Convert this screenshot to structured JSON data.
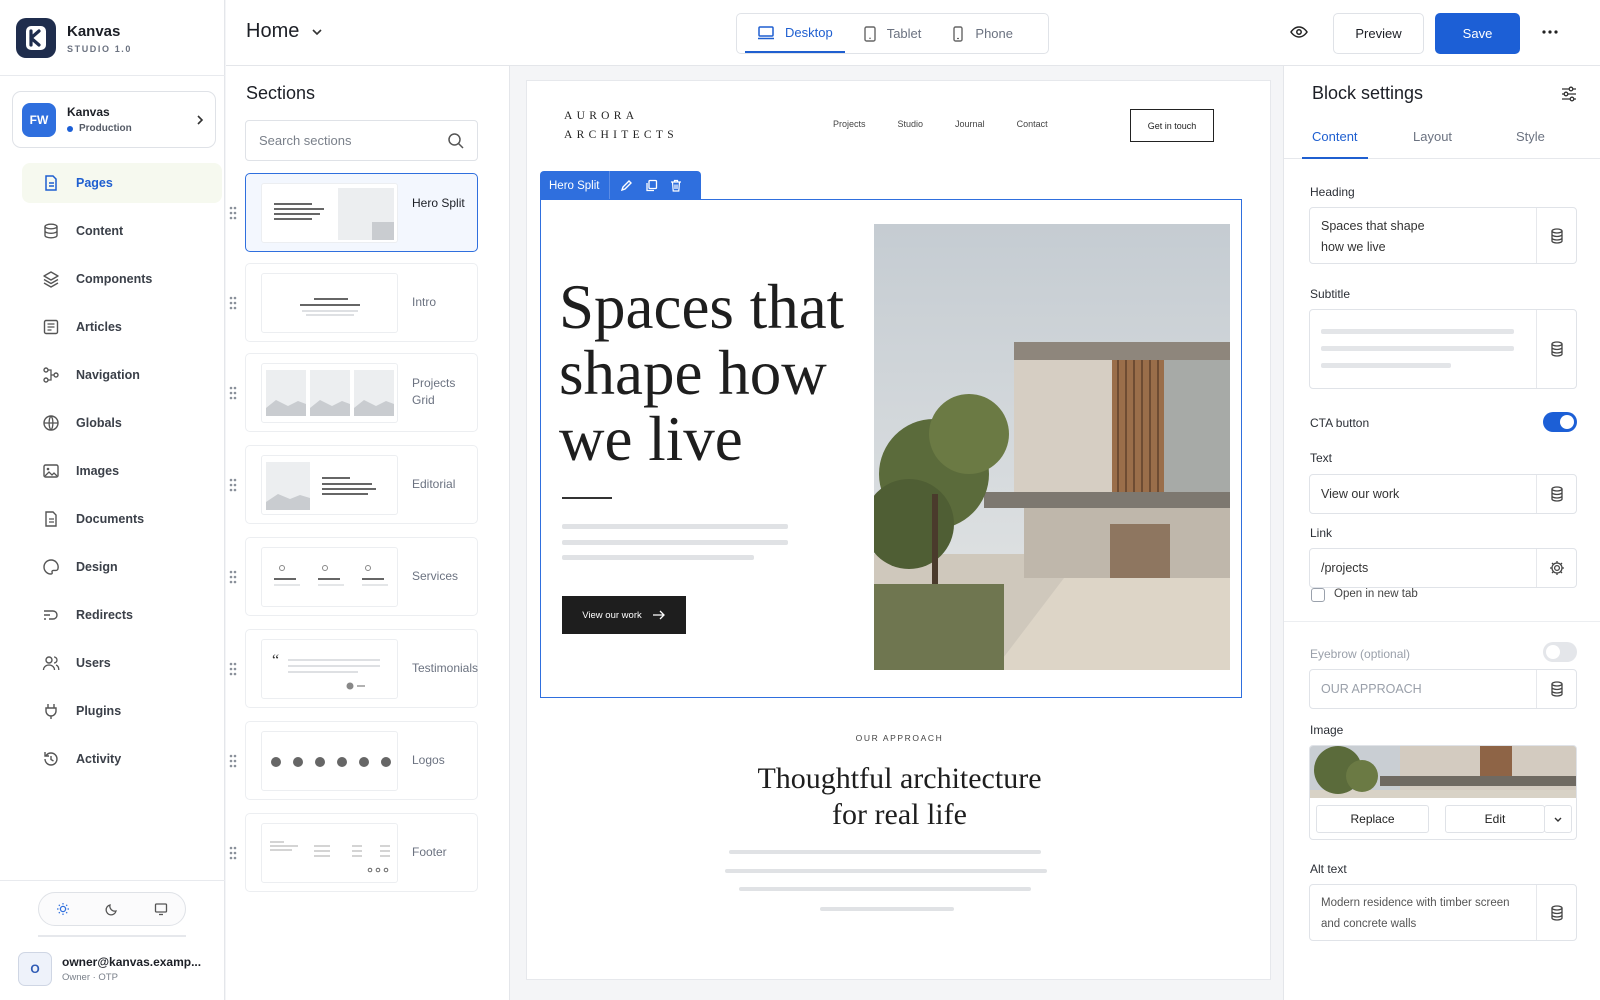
{
  "app": {
    "name": "Kanvas",
    "version": "STUDIO 1.0",
    "logo_letter": "K"
  },
  "workspace": {
    "initials": "FW",
    "name": "Kanvas",
    "env": "Production"
  },
  "nav": [
    {
      "label": "Pages",
      "icon": "page-icon",
      "active": true
    },
    {
      "label": "Content",
      "icon": "database-icon"
    },
    {
      "label": "Components",
      "icon": "layers-icon"
    },
    {
      "label": "Articles",
      "icon": "article-icon"
    },
    {
      "label": "Navigation",
      "icon": "route-icon"
    },
    {
      "label": "Globals",
      "icon": "globe-icon"
    },
    {
      "label": "Images",
      "icon": "image-icon"
    },
    {
      "label": "Documents",
      "icon": "document-icon"
    },
    {
      "label": "Design",
      "icon": "palette-icon"
    },
    {
      "label": "Redirects",
      "icon": "redirect-icon"
    },
    {
      "label": "Users",
      "icon": "users-icon"
    },
    {
      "label": "Plugins",
      "icon": "plug-icon"
    },
    {
      "label": "Activity",
      "icon": "history-icon"
    }
  ],
  "user": {
    "initial": "O",
    "email": "owner@kanvas.examp...",
    "role": "Owner · OTP"
  },
  "topbar": {
    "page": "Home",
    "devices": [
      {
        "label": "Desktop",
        "icon": "desktop-icon",
        "active": true
      },
      {
        "label": "Tablet",
        "icon": "tablet-icon"
      },
      {
        "label": "Phone",
        "icon": "phone-icon"
      }
    ],
    "preview_label": "Preview",
    "save_label": "Save"
  },
  "sections_panel": {
    "title": "Sections",
    "search_placeholder": "Search sections",
    "items": [
      "Hero Split",
      "Intro",
      "Projects Grid",
      "Editorial",
      "Services",
      "Testimonials",
      "Logos",
      "Footer"
    ],
    "active": "Hero Split"
  },
  "site": {
    "logo_line1": "AURORA",
    "logo_line2": "ARCHITECTS",
    "nav": [
      "Projects",
      "Studio",
      "Journal",
      "Contact"
    ],
    "cta": "Get in touch",
    "block_label": "Hero Split",
    "hero_heading": "Spaces that shape how we live",
    "hero_button": "View our work",
    "eyebrow": "OUR APPROACH",
    "approach_line1": "Thoughtful architecture",
    "approach_line2": "for real life"
  },
  "settings": {
    "title": "Block settings",
    "tabs": [
      "Content",
      "Layout",
      "Style"
    ],
    "active_tab": "Content",
    "heading_label": "Heading",
    "heading_line1": "Spaces that shape",
    "heading_line2": "how we live",
    "subtitle_label": "Subtitle",
    "cta_label": "CTA button",
    "cta_enabled": true,
    "text_label": "Text",
    "text_value": "View our work",
    "link_label": "Link",
    "link_value": "/projects",
    "new_tab_label": "Open in new tab",
    "new_tab_checked": false,
    "eyebrow_label": "Eyebrow (optional)",
    "eyebrow_enabled": false,
    "eyebrow_placeholder": "OUR APPROACH",
    "image_label": "Image",
    "replace_label": "Replace",
    "edit_label": "Edit",
    "alt_label": "Alt text",
    "alt_line1": "Modern residence with timber screen",
    "alt_line2": "and concrete walls"
  },
  "colors": {
    "accent": "#1c5fd6",
    "active_nav_bg": "#f6f9ef",
    "dark": "#1e1e1e"
  }
}
